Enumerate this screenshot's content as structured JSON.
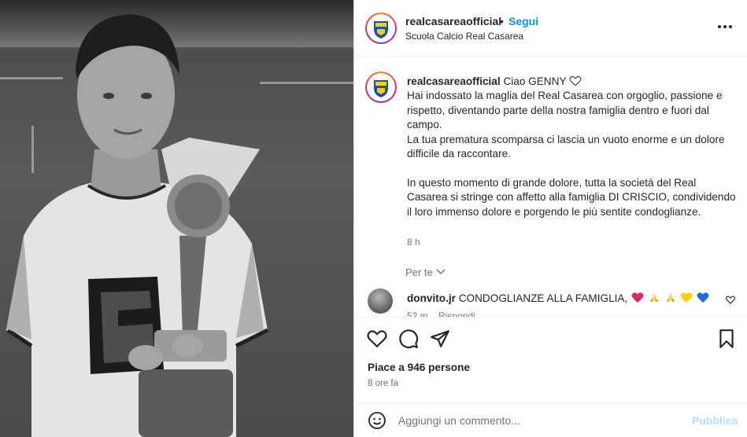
{
  "post": {
    "username": "realcasareaofficial",
    "separator": "•",
    "follow_label": "Segui",
    "subtitle": "Scuola Calcio Real Casarea",
    "more_icon": "more-horizontal-icon"
  },
  "caption": {
    "username": "realcasareaofficial",
    "first_line": "Ciao GENNY",
    "paragraph1": "Hai indossato la maglia del Real Casarea con orgoglio, passione e rispetto, diventando parte della nostra famiglia dentro e fuori dal campo.",
    "paragraph2": "La tua prematura scomparsa ci lascia un vuoto enorme e un dolore difficile da raccontare.",
    "paragraph3": "In questo momento di grande dolore, tutta la società del Real Casarea si stringe con affetto alla famiglia DI CRISCIO, condividendo il loro immenso dolore e porgendo le più sentite condoglianze.",
    "time": "8 h",
    "translate_label": "Per te"
  },
  "comment": {
    "username": "donvito.jr",
    "text": "CONDOGLIANZE ALLA FAMIGLIA,",
    "emoji": [
      "red-heart",
      "folded-hands",
      "folded-hands",
      "yellow-heart",
      "blue-heart"
    ],
    "time": "52 m",
    "reply_label": "Rispondi"
  },
  "actions": {
    "likes_text": "Piace a 946 persone",
    "ago": "8 ore fa"
  },
  "add_comment": {
    "placeholder": "Aggiungi un commento...",
    "post_label": "Pubblica"
  },
  "colors": {
    "accent": "#0095f6",
    "post_disabled": "#b2dffc",
    "secondary_text": "#737373"
  }
}
